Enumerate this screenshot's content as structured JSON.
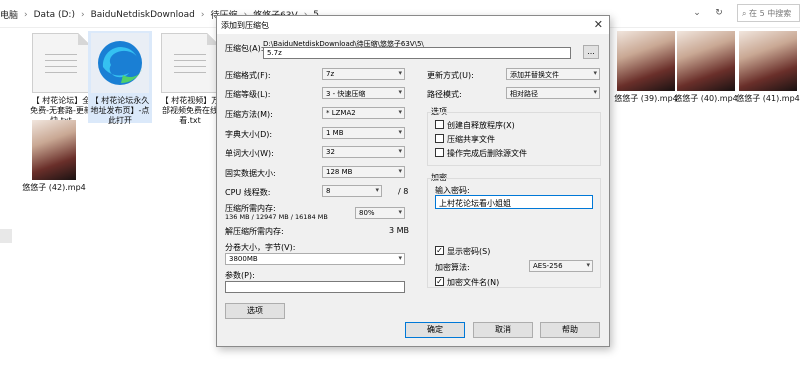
{
  "explorer": {
    "breadcrumb": [
      "电脑",
      "Data (D:)",
      "BaiduNetdiskDownload",
      "待压缩",
      "悠悠子63V",
      "5"
    ],
    "search_placeholder": "在 5 中搜索",
    "files": [
      {
        "name": "【 村花论坛】全免费-无套路-更新快.txt",
        "kind": "txt"
      },
      {
        "name": "【 村花论坛永久地址发布页】-点此打开",
        "kind": "edge"
      },
      {
        "name": "【 村花视频】万部视频免费在线看.txt",
        "kind": "txt"
      },
      {
        "name": "悠悠子 (39).mp4",
        "kind": "video"
      },
      {
        "name": "悠悠子 (40).mp4",
        "kind": "video"
      },
      {
        "name": "悠悠子 (41).mp4",
        "kind": "video"
      },
      {
        "name": "悠悠子 (42).mp4",
        "kind": "video"
      }
    ]
  },
  "dialog": {
    "title": "添加到压缩包",
    "archive_label": "压缩包(A):",
    "archive_path": "D:\\BaiduNetdiskDownload\\待压缩\\悠悠子63V\\5\\",
    "archive_name": "5.7z",
    "browse_label": "...",
    "format_label": "压缩格式(F):",
    "format_value": "7z",
    "level_label": "压缩等级(L):",
    "level_value": "3 - 快速压缩",
    "method_label": "压缩方法(M):",
    "method_value": "* LZMA2",
    "dict_label": "字典大小(D):",
    "dict_value": "1 MB",
    "word_label": "单词大小(W):",
    "word_value": "32",
    "solid_label": "固实数据大小:",
    "solid_value": "128 MB",
    "cpu_label": "CPU 线程数:",
    "cpu_value": "8",
    "cpu_total": "/ 8",
    "mem_compress_label": "压缩所需内存:",
    "mem_compress_detail": "136 MB / 12947 MB / 16184 MB",
    "mem_percent": "80%",
    "mem_decompress_label": "解压缩所需内存:",
    "mem_decompress_value": "3 MB",
    "volume_label": "分卷大小，字节(V):",
    "volume_value": "3800MB",
    "params_label": "参数(P):",
    "params_value": "",
    "options_button": "选项",
    "update_label": "更新方式(U):",
    "update_value": "添加并替换文件",
    "pathmode_label": "路径模式:",
    "pathmode_value": "相对路径",
    "options_group": "选项",
    "opt_sfx": "创建自释放程序(X)",
    "opt_shared": "压缩共享文件",
    "opt_delete": "操作完成后删除源文件",
    "encrypt_group": "加密",
    "password_label": "输入密码:",
    "password_value": "上村花论坛看小姐姐",
    "show_password": "显示密码(S)",
    "enc_method_label": "加密算法:",
    "enc_method_value": "AES-256",
    "encrypt_names": "加密文件名(N)",
    "ok": "确定",
    "cancel": "取消",
    "help": "帮助"
  }
}
